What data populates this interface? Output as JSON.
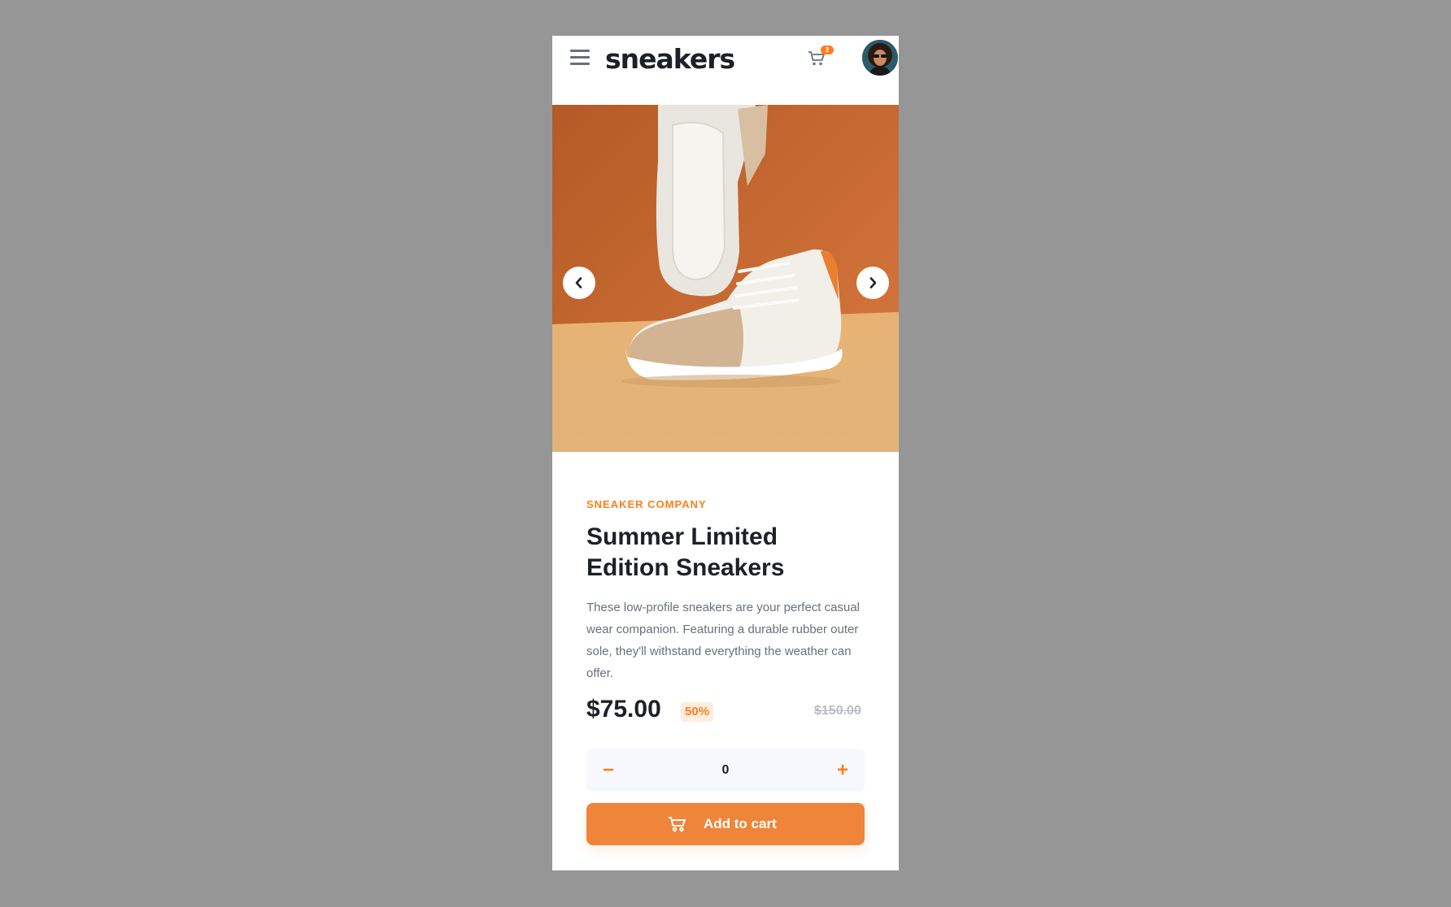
{
  "header": {
    "logo_text": "sneakers",
    "cart_count": "2",
    "icons": {
      "menu": "hamburger-menu-icon",
      "cart": "cart-icon",
      "avatar": "user-avatar"
    }
  },
  "gallery": {
    "prev_icon": "chevron-left-icon",
    "next_icon": "chevron-right-icon"
  },
  "product": {
    "company": "SNEAKER COMPANY",
    "title": "Summer Limited Edition Sneakers",
    "description": "These low-profile sneakers are your perfect casual wear companion. Featuring a durable rubber outer sole, they'll withstand everything the weather can offer.",
    "price": "$75.00",
    "discount": "50%",
    "old_price": "$150.00"
  },
  "quantity": {
    "minus_label": "−",
    "value": "0",
    "plus_label": "+"
  },
  "actions": {
    "add_to_cart_label": "Add to cart"
  },
  "colors": {
    "accent": "#ff7e1b",
    "button": "#ef853a",
    "page_background": "#969696",
    "heading": "#1d2026",
    "body_text": "#68707d"
  }
}
